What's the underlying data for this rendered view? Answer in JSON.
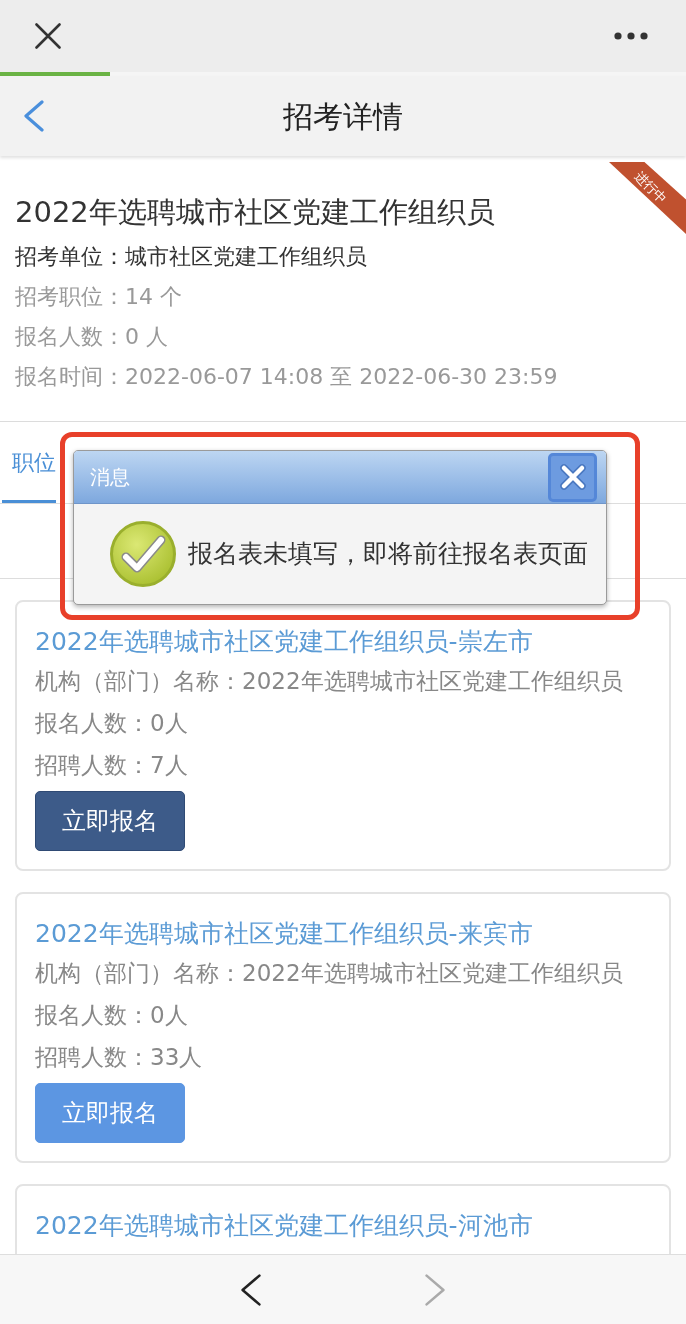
{
  "browser": {
    "progress": {
      "level": 0.16
    }
  },
  "nav_bar": {
    "title": "招考详情"
  },
  "exam": {
    "title": "2022年选聘城市社区党建工作组织员",
    "status": "进行中",
    "details": [
      {
        "kind": "primary",
        "text": "招考单位：城市社区党建工作组织员"
      },
      {
        "kind": "secondary",
        "text": "招考职位：14 个"
      },
      {
        "kind": "secondary",
        "text": "报名人数：0 人"
      },
      {
        "kind": "secondary",
        "text": "报名时间：2022-06-07 14:08 至 2022-06-30 23:59"
      }
    ]
  },
  "tabs": [
    {
      "label": "职位",
      "selected": true
    }
  ],
  "positions": [
    {
      "title": "2022年选聘城市社区党建工作组织员-崇左市",
      "details": [
        "机构（部门）名称：2022年选聘城市社区党建工作组织员",
        "报名人数：0人",
        "招聘人数：7人"
      ],
      "button": {
        "label": "立即报名",
        "active": true
      }
    },
    {
      "title": "2022年选聘城市社区党建工作组织员-来宾市",
      "details": [
        "机构（部门）名称：2022年选聘城市社区党建工作组织员",
        "报名人数：0人",
        "招聘人数：33人"
      ],
      "button": {
        "label": "立即报名",
        "active": false
      }
    },
    {
      "title": "2022年选聘城市社区党建工作组织员-河池市"
    }
  ],
  "dialog": {
    "title": "消息",
    "message": "报名表未填写，即将前往报名表页面"
  },
  "bottom_bar": {
    "back": {
      "disabled": false
    },
    "forward": {
      "disabled": true
    }
  }
}
